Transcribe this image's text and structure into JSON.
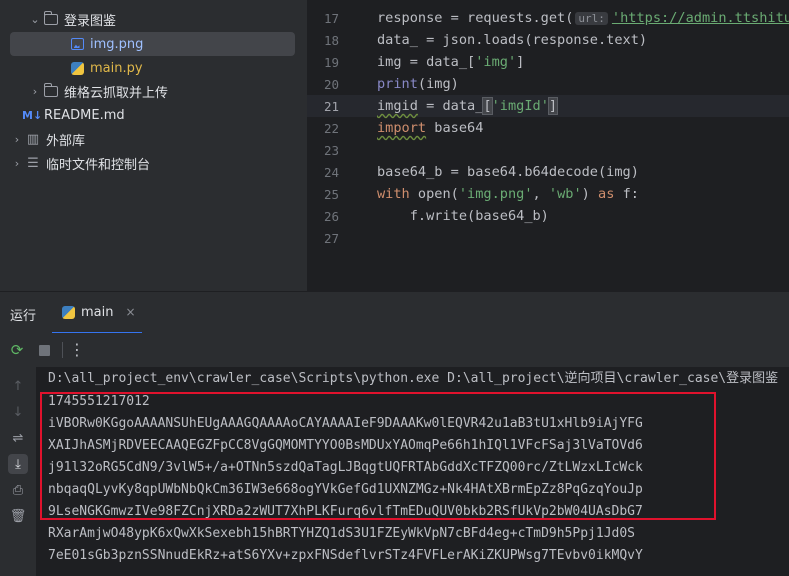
{
  "project_tree": {
    "folder_login": "登录图鉴",
    "file_img": "img.png",
    "file_main": "main.py",
    "folder_weige": "维格云抓取并上传",
    "file_readme": "README.md",
    "external_libs": "外部库",
    "scratches": "临时文件和控制台",
    "md_badge": "M↓"
  },
  "editor": {
    "line_numbers": [
      "17",
      "18",
      "19",
      "20",
      "21",
      "22",
      "23",
      "24",
      "25",
      "26",
      "27"
    ],
    "url_hint": "url:",
    "lines": {
      "l17_a": "response = requests.get(",
      "l17_b": "'https://admin.ttshitu.c",
      "l18_a": "data_ = json.loads(response.text)",
      "l19_a": "img = data_[",
      "l19_b": "'img'",
      "l19_c": "]",
      "l20_a": "print",
      "l20_b": "(img)",
      "l21_a": "imgid",
      "l21_b": " = data_",
      "l21_c": "[",
      "l21_d": "'imgId'",
      "l21_e": "]",
      "l22_a": "import",
      "l22_b": " base64",
      "l24_a": "base64_b = base64.b64decode(img)",
      "l25_a": "with",
      "l25_b": " open(",
      "l25_c": "'img.png'",
      "l25_d": ", ",
      "l25_e": "'wb'",
      "l25_f": ") ",
      "l25_g": "as",
      "l25_h": " f:",
      "l26_a": "    f.write(base64_b)"
    }
  },
  "run_panel": {
    "title": "运行",
    "tab_label": "main",
    "close_glyph": "×"
  },
  "console": {
    "lines": [
      "D:\\all_project_env\\crawler_case\\Scripts\\python.exe D:\\all_project\\逆向项目\\crawler_case\\登录图鉴",
      "1745551217012",
      "iVBORw0KGgoAAAANSUhEUgAAAGQAAAAoCAYAAAAIeF9DAAAKw0lEQVR42u1aB3tU1xHlb9iAjYFG",
      "XAIJhASMjRDVEECAAQEGZFpCC8VgGQMOMTYYO0BsMDUxYAOmqPe66h1hIQl1VFcFSaj3lVaTOVd6",
      "j91l32oRG5CdN9/3vlW5+/a+OTNn5szdQaTagLJBqgtUQFRTAbGddXcTFZQ00rc/ZtLWzxLIcWck",
      "nbqaqQLyvKy8qpUWbNbQkCm36IW3e668ogYVkGefGd1UXNZMGz+Nk4HAtXBrmEpZz8PqGzqYouJp",
      "9LseNGKGmwzIVe98FZCnjXRDa2zWUT7XhPLKFurq6vlfTmEDuQUV0bkb2RSfUkVp2bW04UAsDbG7",
      "RXarAmjwO48ypK6xQwXkSexebh15hBRTYHZQ1dS3U1FZEyWkVpN7cBFd4eg+cTmD9h5Ppj1Jd0S",
      "7eE01sGb3pznSSNnudEkRz+atS6YXv+zpxFNSdeflvrSTz4FVFLerAKiZKUPWsg7TEvbv0ikMQvY"
    ]
  }
}
